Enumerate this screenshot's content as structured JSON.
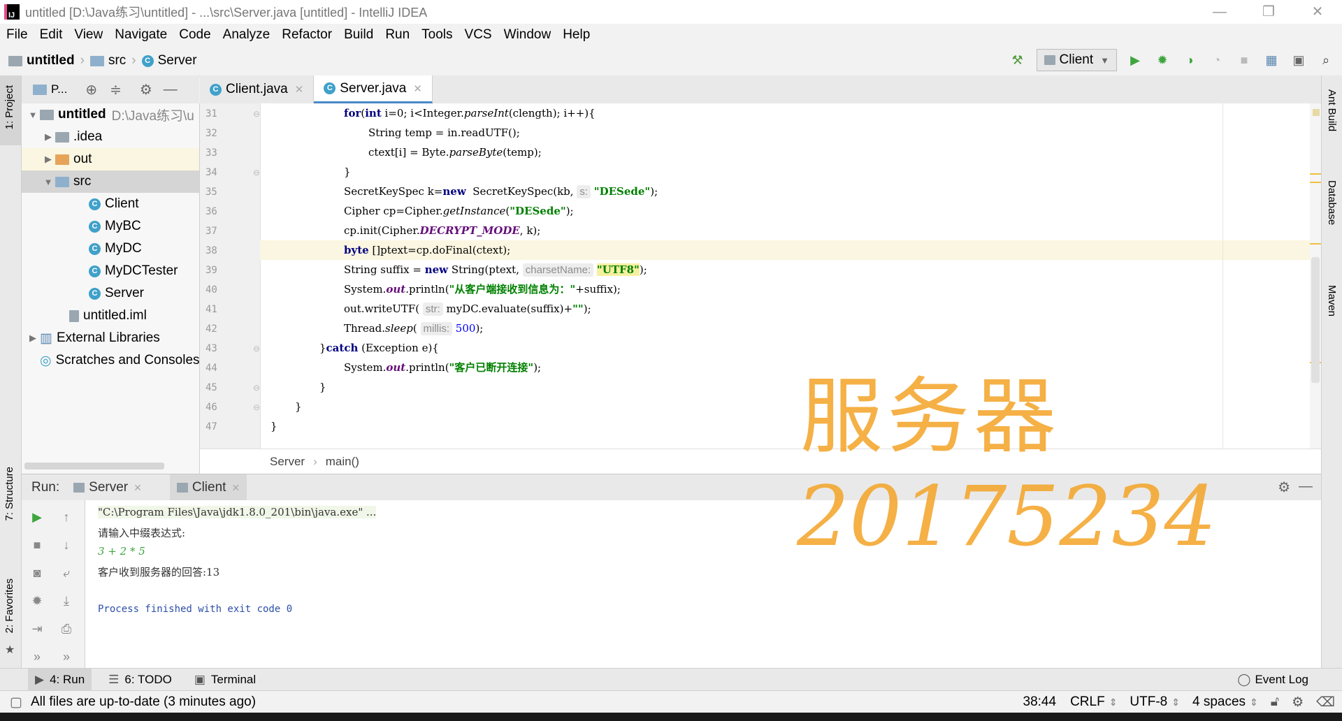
{
  "window": {
    "title": "untitled [D:\\Java练习\\untitled] - ...\\src\\Server.java [untitled] - IntelliJ IDEA",
    "logo_text": "IJ",
    "controls": [
      "—",
      "❐",
      "✕"
    ]
  },
  "menu": [
    "File",
    "Edit",
    "View",
    "Navigate",
    "Code",
    "Analyze",
    "Refactor",
    "Build",
    "Run",
    "Tools",
    "VCS",
    "Window",
    "Help"
  ],
  "navbar": {
    "crumbs": [
      "untitled",
      "src",
      "Server"
    ],
    "run_config": "Client"
  },
  "left_strip": {
    "project": "1: Project",
    "structure": "7: Structure",
    "favorites": "2: Favorites"
  },
  "right_strip": {
    "ant": "Ant Build",
    "database": "Database",
    "maven": "Maven"
  },
  "project": {
    "header": "P...",
    "tree": [
      {
        "label": "untitled",
        "extra": "D:\\Java练习\\u",
        "kind": "module"
      },
      {
        "label": ".idea",
        "kind": "folder"
      },
      {
        "label": "out",
        "kind": "folder-orange"
      },
      {
        "label": "src",
        "kind": "folder-blue"
      },
      {
        "label": "Client",
        "kind": "class"
      },
      {
        "label": "MyBC",
        "kind": "class"
      },
      {
        "label": "MyDC",
        "kind": "class"
      },
      {
        "label": "MyDCTester",
        "kind": "class"
      },
      {
        "label": "Server",
        "kind": "class"
      },
      {
        "label": "untitled.iml",
        "kind": "file"
      },
      {
        "label": "External Libraries",
        "kind": "lib"
      },
      {
        "label": "Scratches and Consoles",
        "kind": "scratch"
      }
    ]
  },
  "tabs": [
    {
      "label": "Client.java",
      "active": false
    },
    {
      "label": "Server.java",
      "active": true
    }
  ],
  "editor": {
    "line_numbers": [
      "31",
      "32",
      "33",
      "34",
      "35",
      "36",
      "37",
      "38",
      "39",
      "40",
      "41",
      "42",
      "43",
      "44",
      "45",
      "46",
      "47"
    ],
    "code": {
      "l31a": "for",
      "l31b": "(",
      "l31c": "int",
      "l31d": " i=0; i<Integer.",
      "l31e": "parseInt",
      "l31f": "(clength); i++){",
      "l32": "String temp = in.readUTF();",
      "l33a": "ctext[i] = Byte.",
      "l33b": "parseByte",
      "l33c": "(temp);",
      "l34": "}",
      "l35a": "SecretKeySpec k=",
      "l35b": "new",
      "l35c": "  SecretKeySpec(kb, ",
      "l35h": "s:",
      "l35d": "\"DESede\"",
      "l35e": ");",
      "l36a": "Cipher cp=Cipher.",
      "l36b": "getInstance",
      "l36c": "(",
      "l36d": "\"DESede\"",
      "l36e": ");",
      "l37a": "cp.init(Cipher.",
      "l37b": "DECRYPT_MODE",
      "l37c": ", k);",
      "l38a": "byte",
      "l38b": " []ptext=cp.doFinal(ctext);",
      "l39a": "String suffix = ",
      "l39b": "new",
      "l39c": " String(ptext, ",
      "l39h": "charsetName:",
      "l39d": "\"UTF8\"",
      "l39e": ");",
      "l40a": "System.",
      "l40b": "out",
      "l40c": ".println(",
      "l40d": "\"从客户端接收到信息为：\"",
      "l40e": "+suffix);",
      "l41a": "out.writeUTF( ",
      "l41h": "str:",
      "l41c": " myDC.evaluate(suffix)+",
      "l41d": "\"\"",
      "l41e": ");",
      "l42a": "Thread.",
      "l42b": "sleep",
      "l42c": "( ",
      "l42h": "millis:",
      "l42d": "500",
      "l42e": ");",
      "l43a": "}",
      "l43b": "catch",
      "l43c": " (Exception e){",
      "l44a": "System.",
      "l44b": "out",
      "l44c": ".println(",
      "l44d": "\"客户已断开连接\"",
      "l44e": ");",
      "l45": "}",
      "l46": "}",
      "l47": "}"
    },
    "breadcrumb": [
      "Server",
      "main()"
    ]
  },
  "run": {
    "label": "Run:",
    "tabs": [
      "Server",
      "Client"
    ],
    "console": [
      "\"C:\\Program Files\\Java\\jdk1.8.0_201\\bin\\java.exe\" ...",
      "请输入中缀表达式:",
      "3 + 2 * 5",
      "客户收到服务器的回答:13",
      "",
      "Process finished with exit code 0"
    ]
  },
  "bottom_tabs": [
    "4: Run",
    "6: TODO",
    "Terminal"
  ],
  "event_log": "Event Log",
  "status": {
    "message": "All files are up-to-date (3 minutes ago)",
    "position": "38:44",
    "line_sep": "CRLF",
    "encoding": "UTF-8",
    "indent": "4 spaces"
  },
  "overlay": {
    "line1": "服务器",
    "line2": "20175234"
  },
  "colors": {
    "accent": "#4a88c7",
    "keyword": "#000080",
    "string": "#008000",
    "overlay": "#f4a832"
  }
}
